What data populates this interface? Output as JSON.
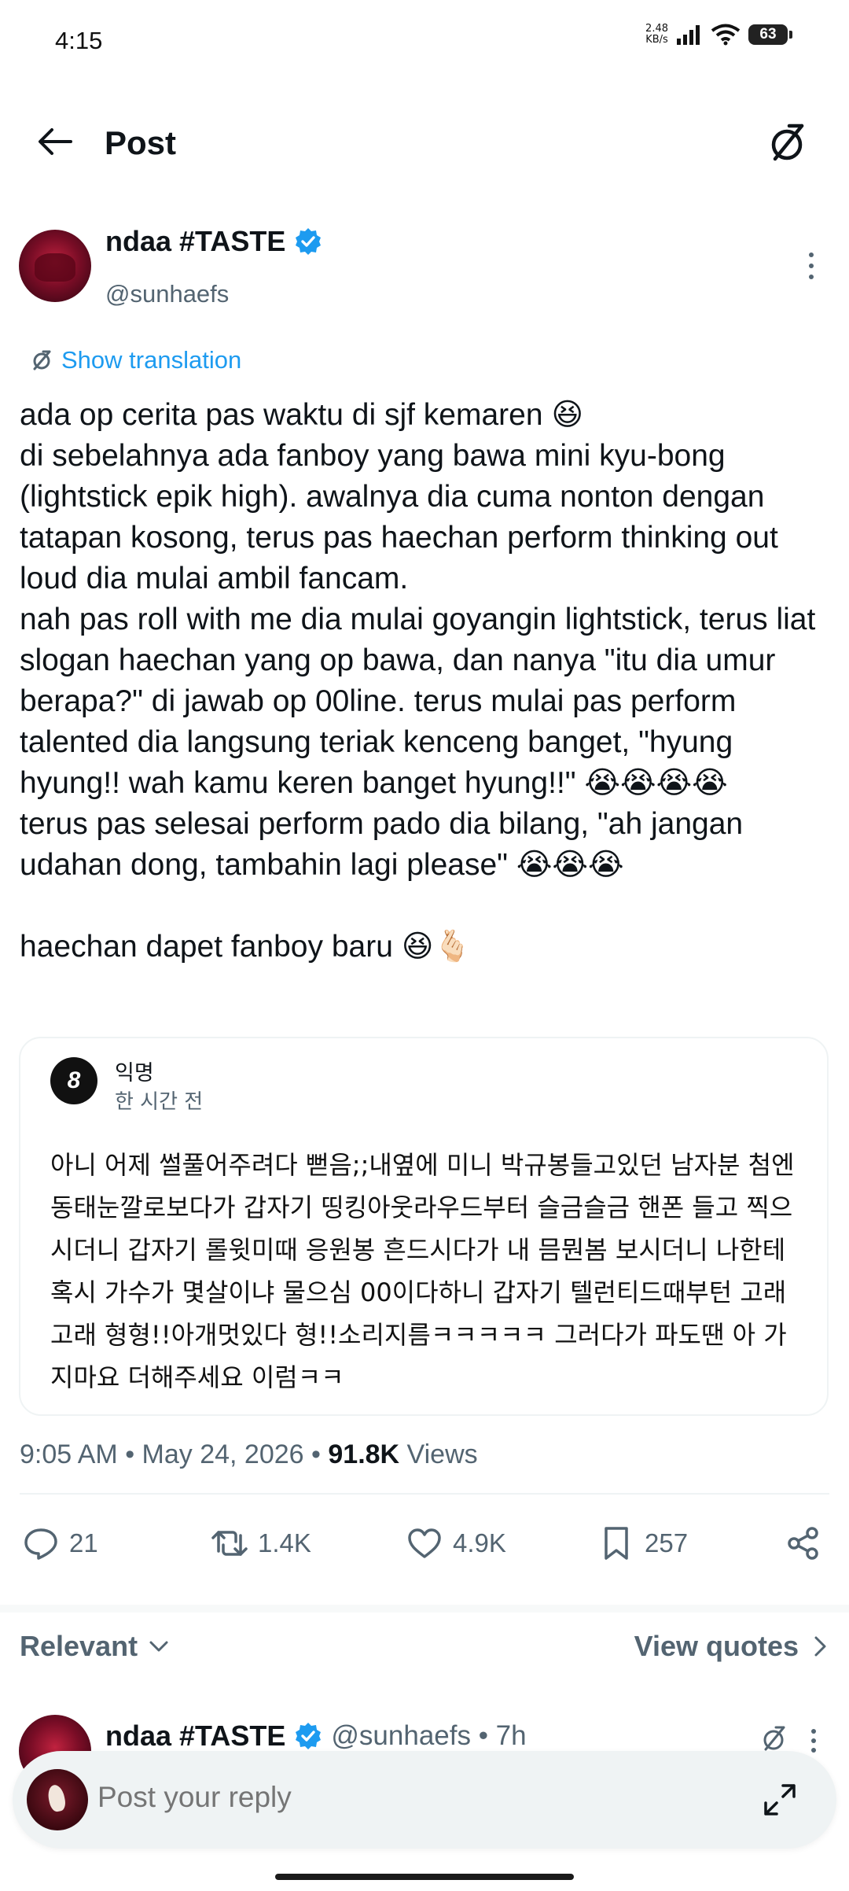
{
  "status_bar": {
    "time": "4:15",
    "net_speed_value": "2.48",
    "net_speed_unit": "KB/s",
    "battery": "63"
  },
  "header": {
    "title": "Post"
  },
  "tweet": {
    "author_name": "ndaa #TASTE",
    "author_handle": "@sunhaefs",
    "show_translation": "Show translation",
    "lines": [
      "ada op cerita pas waktu di sjf kemaren 😆",
      "di sebelahnya ada fanboy yang bawa mini kyu-bong (lightstick epik high). awalnya dia cuma nonton dengan tatapan kosong, terus pas haechan perform thinking out loud dia mulai ambil fancam.",
      "nah pas roll with me dia mulai goyangin lightstick, terus liat slogan haechan yang op bawa, dan nanya \"itu dia umur berapa?\" di jawab op 00line. terus mulai pas perform talented dia langsung teriak kenceng banget, \"hyung hyung!! wah kamu keren banget hyung!!\" 😭😭😭😭",
      "terus pas selesai perform pado dia bilang, \"ah jangan udahan dong, tambahin lagi please\" 😭😭😭",
      "haechan dapet fanboy baru 😆🫰🏻"
    ],
    "timestamp": "9:05 AM • May 24, 2026 • ",
    "views_count": "91.8K",
    "views_label": " Views"
  },
  "quote": {
    "avatar_glyph": "8",
    "name": "익명",
    "time": "한 시간 전",
    "text": "아니 어제 썰풀어주려다 뻗음;;내옆에 미니 박규봉들고있던 남자분 첨엔 동태눈깔로보다가 갑자기 띵킹아웃라우드부터 슬금슬금 핸폰 들고 찍으시더니 갑자기 롤윗미때 응원봉 흔드시다가 내 믐뭔봄 보시더니 나한테 혹시 가수가 몇살이냐 물으심 00이다하니 갑자기 텔런티드때부턴 고래고래 형형!!아개멋있다 형!!소리지름ㅋㅋㅋㅋㅋ 그러다가 파도땐 아 가지마요 더해주세요 이럼ㅋㅋ"
  },
  "actions": {
    "replies": "21",
    "reposts": "1.4K",
    "likes": "4.9K",
    "bookmarks": "257"
  },
  "replies_section": {
    "sort_label": "Relevant",
    "view_quotes": "View quotes",
    "reply_author_name": "ndaa #TASTE",
    "reply_author_meta": "@sunhaefs • 7h"
  },
  "composer": {
    "placeholder": "Post your reply"
  },
  "colors": {
    "accent": "#1d9bf0",
    "secondary_text": "#536471",
    "primary_text": "#0f1419"
  }
}
